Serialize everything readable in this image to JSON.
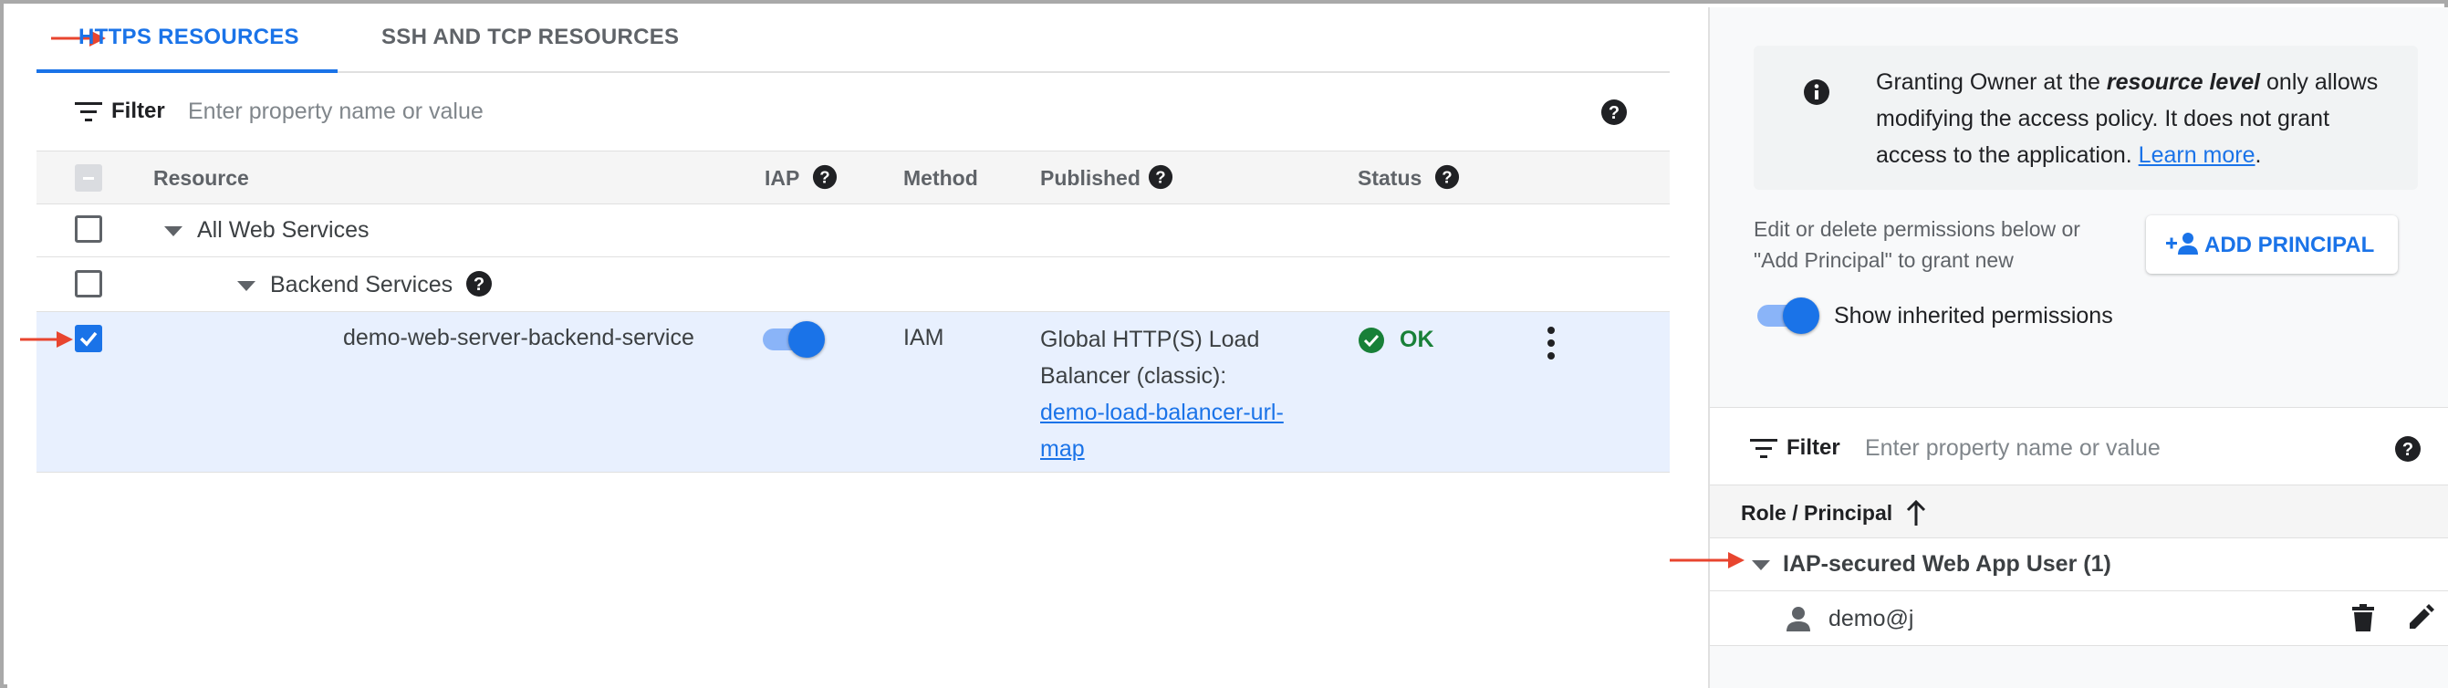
{
  "tabs": [
    {
      "label": "HTTPS RESOURCES",
      "active": true
    },
    {
      "label": "SSH AND TCP RESOURCES",
      "active": false
    }
  ],
  "filter": {
    "label": "Filter",
    "placeholder": "Enter property name or value"
  },
  "table": {
    "columns": [
      "Resource",
      "IAP",
      "Method",
      "Published",
      "Status"
    ],
    "rows": [
      {
        "resource": "All Web Services"
      },
      {
        "resource": "Backend Services"
      },
      {
        "resource": "demo-web-server-backend-service",
        "iap_enabled": true,
        "method": "IAM",
        "published_text": "Global HTTP(S) Load Balancer (classic):",
        "published_link": "demo-load-balancer-url-map",
        "status": "OK",
        "checked": true
      }
    ]
  },
  "side_panel": {
    "info": {
      "prefix": "Granting Owner at the ",
      "emphasis": "resource level",
      "suffix": " only allows modifying the access policy. It does not grant access to the application. ",
      "link": "Learn more",
      "end": "."
    },
    "edit_text": "Edit or delete permissions below or \"Add Principal\" to grant new",
    "add_principal_label": "ADD PRINCIPAL",
    "show_inherited_label": "Show inherited permissions",
    "show_inherited_on": true,
    "filter": {
      "label": "Filter",
      "placeholder": "Enter property name or value"
    },
    "column": "Role / Principal",
    "role_group": "IAP-secured Web App User (1)",
    "principal": "demo@j"
  },
  "colors": {
    "accent": "#1a73e8",
    "ok": "#188038",
    "annotation_arrow": "#e8452f"
  }
}
